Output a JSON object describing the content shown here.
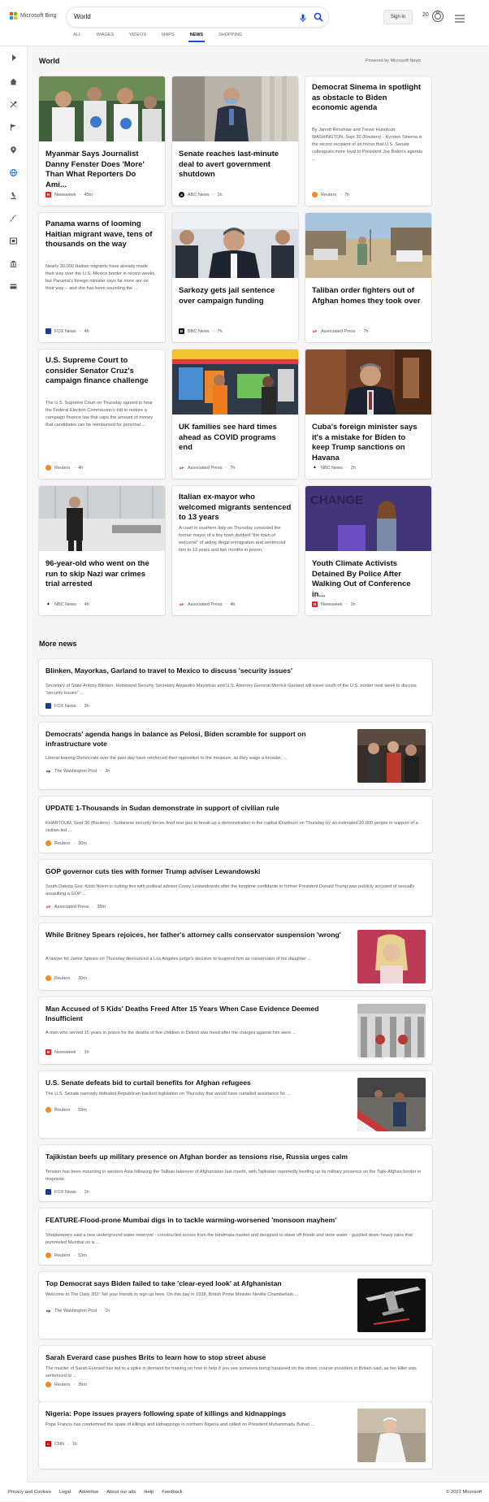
{
  "app": {
    "brand": "Microsoft Bing",
    "logo_colors": [
      "#f25022",
      "#7fba00",
      "#00a4ef",
      "#ffb900"
    ]
  },
  "search": {
    "query": "World"
  },
  "header": {
    "sign_in": "Sign in",
    "points": "20"
  },
  "tabs": [
    {
      "label": "ALL"
    },
    {
      "label": "IMAGES"
    },
    {
      "label": "VIDEOS"
    },
    {
      "label": "MAPS"
    },
    {
      "label": "NEWS",
      "active": true
    },
    {
      "label": "SHOPPING"
    }
  ],
  "sidebar": {
    "icons": [
      "expand-icon",
      "home-icon",
      "tools-icon",
      "flag-icon",
      "location-icon",
      "globe-icon",
      "microscope-icon",
      "rocket-icon",
      "film-icon",
      "bank-icon",
      "card-icon"
    ]
  },
  "section": {
    "title": "World",
    "powered_by": "Powered by Microsoft News"
  },
  "cards": [
    {
      "title": "Myanmar Says Journalist Danny Fenster Does 'More' Than What Reporters Do Ami...",
      "source": "Newsweek",
      "time": "45m",
      "snippet": "",
      "has_image": true,
      "image_icon": "photo-protest-icon"
    },
    {
      "title": "Senate reaches last-minute deal to avert government shutdown",
      "source": "ABC News",
      "time": "1h",
      "snippet": "",
      "has_image": true,
      "image_icon": "photo-senator-icon"
    },
    {
      "title": "Democrat Sinema in spotlight as obstacle to Biden economic agenda",
      "source": "Reuters",
      "time": "7h",
      "snippet": "By Jarrett Renshaw and Trevor Hunnicutt WASHINGTON, Sept 30 (Reuters) - Kyrsten Sinema is the recent recipient of an honor that U.S. Senate colleagues more loyal to President Joe Biden's agenda ...",
      "has_image": false
    },
    {
      "title": "Panama warns of looming Haitian migrant wave, tens of thousands on the way",
      "source": "FOX News",
      "time": "4h",
      "snippet": "Nearly 30,000 Haitian migrants have already made their way over the U.S.-Mexico border in recent weeks, but Panama's foreign minister says far more are on their way -- and she has been sounding the ...",
      "has_image": false
    },
    {
      "title": "Sarkozy gets jail sentence over campaign funding",
      "source": "BBC News",
      "time": "7h",
      "snippet": "",
      "has_image": true,
      "image_icon": "photo-sarkozy-icon"
    },
    {
      "title": "Taliban order fighters out of Afghan homes they took over",
      "source": "Associated Press",
      "time": "7h",
      "snippet": "",
      "has_image": true,
      "image_icon": "photo-street-icon"
    },
    {
      "title": "U.S. Supreme Court to consider Senator Cruz's campaign finance challenge",
      "source": "Reuters",
      "time": "4h",
      "snippet": "The U.S. Supreme Court on Thursday agreed to hear the Federal Election Commission's bid to restore a campaign finance law that caps the amount of money that candidates can be reimbursed for personal ...",
      "has_image": false
    },
    {
      "title": "UK families see hard times ahead as COVID programs end",
      "source": "Associated Press",
      "time": "7h",
      "snippet": "",
      "has_image": true,
      "image_icon": "photo-market-icon"
    },
    {
      "title": "Cuba's foreign minister says it's a mistake for Biden to keep Trump sanctions on Havana",
      "source": "NBC News",
      "time": "2h",
      "snippet": "",
      "has_image": true,
      "image_icon": "photo-minister-icon"
    },
    {
      "title": "96-year-old who went on the run to skip Nazi war crimes trial arrested",
      "source": "NBC News",
      "time": "4h",
      "snippet": "",
      "has_image": true,
      "image_icon": "photo-courtroom-icon"
    },
    {
      "title": "Italian ex-mayor who welcomed migrants sentenced to 13 years",
      "source": "Associated Press",
      "time": "4h",
      "snippet": "A court in southern Italy on Thursday convicted the former mayor of a tiny town dubbed \"the town of welcome\" of aiding illegal immigration and sentenced him to 13 years and two months in prison.",
      "has_image": false
    },
    {
      "title": "Youth Climate Activists Detained By Police After Walking Out of Conference in...",
      "source": "Newsweek",
      "time": "1h",
      "snippet": "",
      "has_image": true,
      "image_icon": "photo-conference-icon",
      "image_text": "CHANGE"
    }
  ],
  "more_news": {
    "title": "More news",
    "items": [
      {
        "title": "Blinken, Mayorkas, Garland to travel to Mexico to discuss 'security issues'",
        "snippet": "Secretary of State Antony Blinken, Homeland Security Secretary Alejandro Mayorkas and U.S. Attorney General Merrick Garland will travel south of the U.S. border next week to discuss \"security issues\" ...",
        "source": "FOX News",
        "time": "3h",
        "has_image": false
      },
      {
        "title": "Democrats' agenda hangs in balance as Pelosi, Biden scramble for support on infrastructure vote",
        "snippet": "Liberal-leaning Democrats over the past day have reinforced their opposition to the measure, as they wage a broader, ...",
        "source": "The Washington Post",
        "time": "3h",
        "has_image": true,
        "image_icon": "photo-pelosi-icon"
      },
      {
        "title": "UPDATE 1-Thousands in Sudan demonstrate in support of civilian rule",
        "snippet": "KHARTOUM, Sept 30 (Reuters) - Sudanese security forces fired tear gas to break up a demonstration in the capital Khartoum on Thursday by an estimated 20,000 people in support of a civilian-led ...",
        "source": "Reuters",
        "time": "30m",
        "has_image": false
      },
      {
        "title": "GOP governor cuts ties with former Trump adviser Lewandowski",
        "snippet": "South Dakota Gov. Kristi Noem is cutting ties with political adviser Corey Lewandowski after the longtime confidante to former President Donald Trump was publicly accused of sexually assaulting a GOP ...",
        "source": "Associated Press",
        "time": "38m",
        "has_image": false
      },
      {
        "title": "While Britney Spears rejoices, her father's attorney calls conservator suspension 'wrong'",
        "snippet": "A lawyer for Jamie Spears on Thursday denounced a Los Angeles judge's decision to suspend him as conservator of his daughter ...",
        "source": "Reuters",
        "time": "30m",
        "has_image": true,
        "image_icon": "photo-britney-icon"
      },
      {
        "title": "Man Accused of 5 Kids' Deaths Freed After 15 Years When Case Evidence Deemed Insufficient",
        "snippet": "A man who served 15 years in prison for the deaths of five children in Detroit was freed after the charges against him were ...",
        "source": "Newsweek",
        "time": "1h",
        "has_image": true,
        "image_icon": "photo-courthouse-icon"
      },
      {
        "title": "U.S. Senate defeats bid to curtail benefits for Afghan refugees",
        "snippet": "The U.S. Senate narrowly defeated Republican-backed legislation on Thursday that would have curtailed assistance for ...",
        "source": "Reuters",
        "time": "59m",
        "has_image": true,
        "image_icon": "photo-refugees-icon"
      },
      {
        "title": "Tajikistan beefs up military presence on Afghan border as tensions rise, Russia urges calm",
        "snippet": "Tension has been mounting in western Asia following the Taliban takeover of Afghanistan last month, with Tajikistan reportedly beefing up its military presence on the Tajik-Afghan border in response.",
        "source": "FOX News",
        "time": "1h",
        "has_image": false
      },
      {
        "title": "FEATURE-Flood-prone Mumbai digs in to tackle warming-worsened 'monsoon mayhem'",
        "snippet": "Shopkeepers said a new underground water reservoir - constructed across from the Hindmata market and designed to stave off floods and store water - guzzled down heavy rains that pummeled Mumbai on a ...",
        "source": "Reuters",
        "time": "53m",
        "has_image": false
      },
      {
        "title": "Top Democrat says Biden failed to take 'clear-eyed look' at Afghanistan",
        "snippet": "Welcome to The Daily 202! Tell your friends to sign up here. On this day in 1938, British Prime Minister Neville Chamberlain ...",
        "source": "The Washington Post",
        "time": "1h",
        "has_image": true,
        "image_icon": "photo-drone-icon"
      },
      {
        "title": "Sarah Everard case pushes Brits to learn how to stop street abuse",
        "snippet": "The murder of Sarah Everard has led to a spike in demand for training on how to help if you see someone being harassed on the street, course providers in Britain said, as her killer was sentenced to ...",
        "source": "Reuters",
        "time": "39m",
        "has_image": false
      },
      {
        "title": "Nigeria: Pope issues prayers following spate of killings and kidnappings",
        "snippet": "Pope Francis has condemned the spate of killings and kidnappings in northern Nigeria and called on President Muhammadu Buhari ...",
        "source": "CNN",
        "time": "1h",
        "has_image": true,
        "image_icon": "photo-pope-icon"
      }
    ]
  },
  "sources": {
    "Newsweek": {
      "color": "#e5202e",
      "mark": "N"
    },
    "ABC News": {
      "color": "#111111",
      "mark": "a"
    },
    "Reuters": {
      "color": "#f08a24",
      "mark": "✶"
    },
    "FOX News": {
      "color": "#1a3e8c",
      "mark": "F"
    },
    "BBC News": {
      "color": "#111111",
      "mark": "B"
    },
    "Associated Press": {
      "color": "#ffffff",
      "mark": "AP"
    },
    "NBC News": {
      "color": "#ffffff",
      "mark": "▲"
    },
    "The Washington Post": {
      "color": "#ffffff",
      "mark": "wp"
    },
    "CNN": {
      "color": "#cc0000",
      "mark": "C"
    }
  },
  "footer": {
    "links": [
      "Privacy and Cookies",
      "Legal",
      "Advertise",
      "About our ads",
      "Help",
      "Feedback"
    ],
    "copyright": "© 2021 Microsoft"
  },
  "colors": {
    "accent": "#174ae4",
    "bg": "#f5f5f5"
  }
}
